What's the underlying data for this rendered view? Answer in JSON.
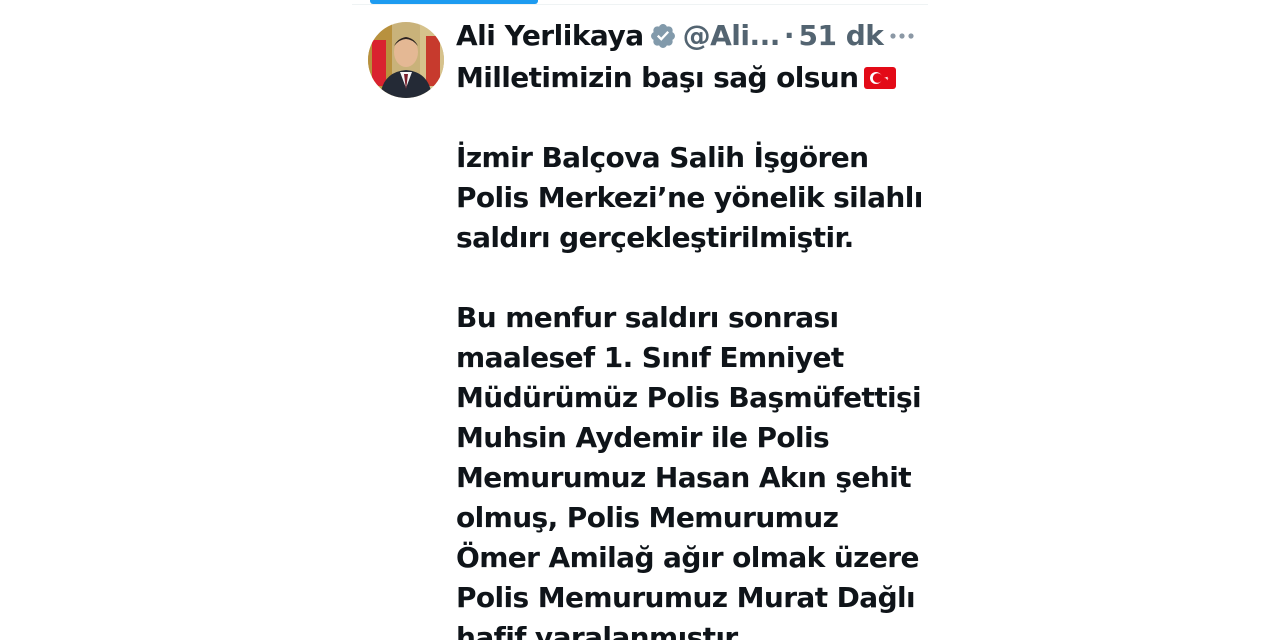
{
  "tweet": {
    "author_name": "Ali Yerlikaya",
    "author_handle": "@Ali...",
    "separator": "·",
    "time": "51 dk",
    "more_label": "•••",
    "first_line": "Milletimizin başı sağ olsun",
    "flag_icon": "turkish-flag-icon",
    "paragraphs": [
      {
        "lines": [
          "İzmir Balçova Salih İşgören",
          "Polis Merkezi’ne yönelik silahlı",
          "saldırı gerçekleştirilmiştir."
        ]
      },
      {
        "lines": [
          "Bu menfur saldırı sonrası",
          "maalesef 1. Sınıf Emniyet",
          "Müdürümüz Polis Başmüfettişi",
          "Muhsin Aydemir ile Polis",
          "Memurumuz Hasan Akın şehit",
          "olmuş, Polis Memurumuz",
          "Ömer Amilağ ağır olmak üzere",
          "Polis Memurumuz Murat Dağlı",
          "hafif yaralanmıştır."
        ]
      }
    ]
  },
  "colors": {
    "text_primary": "#0f1419",
    "text_secondary": "#536471",
    "accent": "#1d9bf0",
    "flag_red": "#e30a17"
  }
}
